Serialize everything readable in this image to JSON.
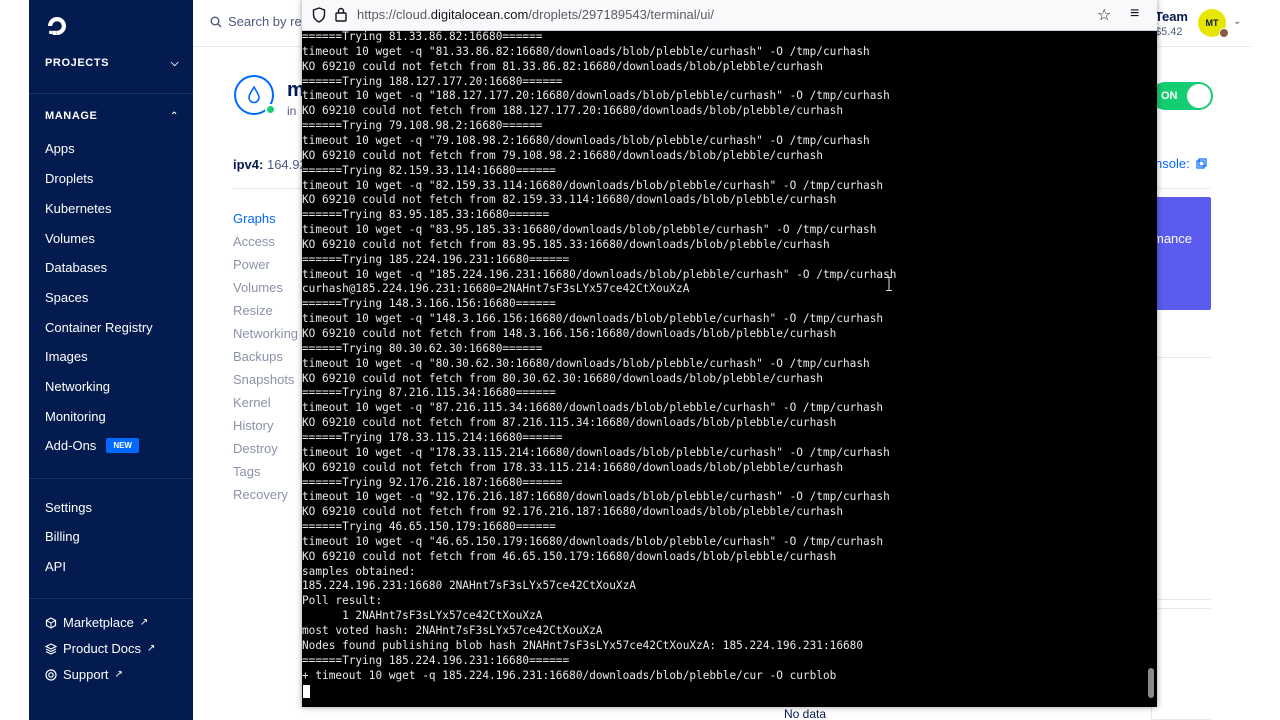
{
  "sidebar": {
    "sections": {
      "projects": "PROJECTS",
      "manage": "MANAGE"
    },
    "manage_items": [
      {
        "label": "Apps"
      },
      {
        "label": "Droplets"
      },
      {
        "label": "Kubernetes"
      },
      {
        "label": "Volumes"
      },
      {
        "label": "Databases"
      },
      {
        "label": "Spaces"
      },
      {
        "label": "Container Registry"
      },
      {
        "label": "Images"
      },
      {
        "label": "Networking"
      },
      {
        "label": "Monitoring"
      },
      {
        "label": "Add-Ons",
        "badge": "NEW"
      }
    ],
    "account_items": [
      {
        "label": "Settings"
      },
      {
        "label": "Billing"
      },
      {
        "label": "API"
      }
    ],
    "footer_items": [
      {
        "label": "Marketplace"
      },
      {
        "label": "Product Docs"
      },
      {
        "label": "Support"
      }
    ]
  },
  "app": {
    "search_placeholder": "Search by res",
    "team": "Team",
    "balance": "$5.42",
    "avatar_initials": "MT",
    "droplet_name": "m",
    "droplet_sub": "in",
    "power_toggle": "ON",
    "ipv4_label": "ipv4:",
    "ipv4_value": "164.92",
    "console_link": "nsole:",
    "promo_text": "mance",
    "no_data": "No data",
    "tabs": [
      "Graphs",
      "Access",
      "Power",
      "Volumes",
      "Resize",
      "Networking",
      "Backups",
      "Snapshots",
      "Kernel",
      "History",
      "Destroy",
      "Tags",
      "Recovery"
    ]
  },
  "browser": {
    "url_prefix": "https://cloud.",
    "url_domain": "digitalocean.com",
    "url_suffix": "/droplets/297189543/terminal/ui/"
  },
  "terminal": {
    "lines": [
      "======Trying 81.33.86.82:16680======",
      "timeout 10 wget -q \"81.33.86.82:16680/downloads/blob/plebble/curhash\" -O /tmp/curhash",
      "KO 69210 could not fetch from 81.33.86.82:16680/downloads/blob/plebble/curhash",
      "======Trying 188.127.177.20:16680======",
      "timeout 10 wget -q \"188.127.177.20:16680/downloads/blob/plebble/curhash\" -O /tmp/curhash",
      "KO 69210 could not fetch from 188.127.177.20:16680/downloads/blob/plebble/curhash",
      "======Trying 79.108.98.2:16680======",
      "timeout 10 wget -q \"79.108.98.2:16680/downloads/blob/plebble/curhash\" -O /tmp/curhash",
      "KO 69210 could not fetch from 79.108.98.2:16680/downloads/blob/plebble/curhash",
      "======Trying 82.159.33.114:16680======",
      "timeout 10 wget -q \"82.159.33.114:16680/downloads/blob/plebble/curhash\" -O /tmp/curhash",
      "KO 69210 could not fetch from 82.159.33.114:16680/downloads/blob/plebble/curhash",
      "======Trying 83.95.185.33:16680======",
      "timeout 10 wget -q \"83.95.185.33:16680/downloads/blob/plebble/curhash\" -O /tmp/curhash",
      "KO 69210 could not fetch from 83.95.185.33:16680/downloads/blob/plebble/curhash",
      "======Trying 185.224.196.231:16680======",
      "timeout 10 wget -q \"185.224.196.231:16680/downloads/blob/plebble/curhash\" -O /tmp/curhash",
      "curhash@185.224.196.231:16680=2NAHnt7sF3sLYx57ce42CtXouXzA",
      "======Trying 148.3.166.156:16680======",
      "timeout 10 wget -q \"148.3.166.156:16680/downloads/blob/plebble/curhash\" -O /tmp/curhash",
      "KO 69210 could not fetch from 148.3.166.156:16680/downloads/blob/plebble/curhash",
      "======Trying 80.30.62.30:16680======",
      "timeout 10 wget -q \"80.30.62.30:16680/downloads/blob/plebble/curhash\" -O /tmp/curhash",
      "KO 69210 could not fetch from 80.30.62.30:16680/downloads/blob/plebble/curhash",
      "======Trying 87.216.115.34:16680======",
      "timeout 10 wget -q \"87.216.115.34:16680/downloads/blob/plebble/curhash\" -O /tmp/curhash",
      "KO 69210 could not fetch from 87.216.115.34:16680/downloads/blob/plebble/curhash",
      "======Trying 178.33.115.214:16680======",
      "timeout 10 wget -q \"178.33.115.214:16680/downloads/blob/plebble/curhash\" -O /tmp/curhash",
      "KO 69210 could not fetch from 178.33.115.214:16680/downloads/blob/plebble/curhash",
      "======Trying 92.176.216.187:16680======",
      "timeout 10 wget -q \"92.176.216.187:16680/downloads/blob/plebble/curhash\" -O /tmp/curhash",
      "KO 69210 could not fetch from 92.176.216.187:16680/downloads/blob/plebble/curhash",
      "======Trying 46.65.150.179:16680======",
      "timeout 10 wget -q \"46.65.150.179:16680/downloads/blob/plebble/curhash\" -O /tmp/curhash",
      "KO 69210 could not fetch from 46.65.150.179:16680/downloads/blob/plebble/curhash",
      "samples obtained:",
      "185.224.196.231:16680 2NAHnt7sF3sLYx57ce42CtXouXzA",
      "Poll result:",
      "      1 2NAHnt7sF3sLYx57ce42CtXouXzA",
      "most voted hash: 2NAHnt7sF3sLYx57ce42CtXouXzA",
      "Nodes found publishing blob hash 2NAHnt7sF3sLYx57ce42CtXouXzA: 185.224.196.231:16680",
      "======Trying 185.224.196.231:16680======",
      "+ timeout 10 wget -q 185.224.196.231:16680/downloads/blob/plebble/cur -O curblob"
    ]
  }
}
